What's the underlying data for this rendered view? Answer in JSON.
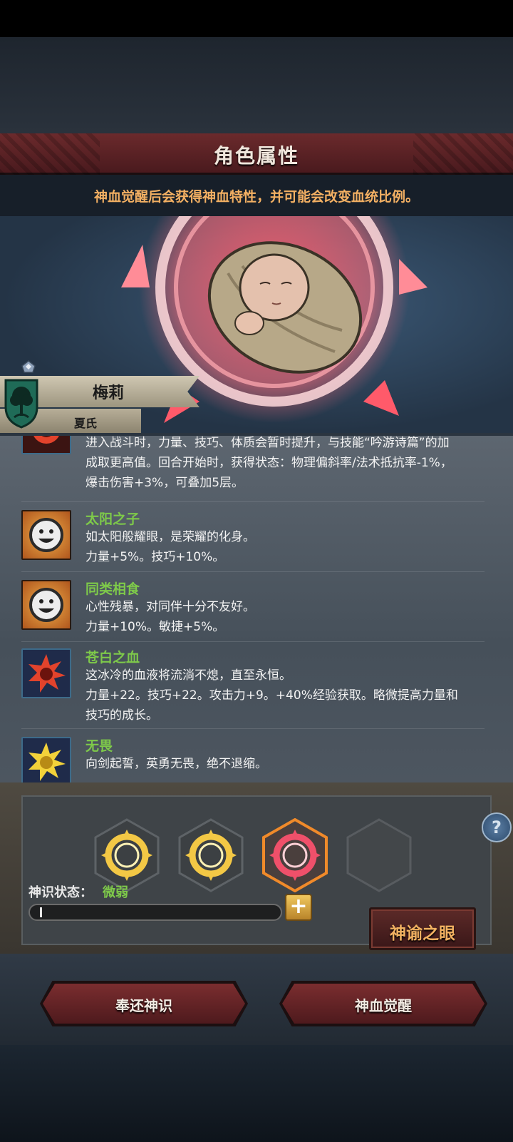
{
  "header": {
    "title": "角色属性",
    "subtitle": "神血觉醒后会获得神血特性，并可能会改变血统比例。"
  },
  "character": {
    "name": "梅莉",
    "family": "夏氏"
  },
  "traits": [
    {
      "name": "",
      "icon": "red-sun-icon",
      "lines": [
        "进入战斗时，力量、技巧、体质会暂时提升，与技能“吟游诗篇”的加",
        "成取更高值。回合开始时，获得状态：物理偏斜率/法术抵抗率-1%，",
        "爆击伤害+3%，可叠加5层。"
      ]
    },
    {
      "name": "太阳之子",
      "icon": "smiley-face-icon",
      "lines": [
        "如太阳般耀眼，是荣耀的化身。",
        "力量+5%。技巧+10%。"
      ]
    },
    {
      "name": "同类相食",
      "icon": "smiley-face-icon",
      "lines": [
        "心性残暴，对同伴十分不友好。",
        "力量+10%。敏捷+5%。"
      ]
    },
    {
      "name": "苍白之血",
      "icon": "red-sun-icon",
      "lines": [
        "这冰冷的血液将流淌不熄，直至永恒。",
        "力量+22。技巧+22。攻击力+9。+40%经验获取。略微提高力量和",
        "技巧的成长。"
      ]
    },
    {
      "name": "无畏",
      "icon": "yellow-sun-icon",
      "lines": [
        "向剑起誓，英勇无畏，绝不退缩。"
      ]
    }
  ],
  "divine": {
    "status_label": "神识状态：",
    "status_value": "微弱",
    "progress": 0.01,
    "slots": [
      "gold-sun-ring-icon",
      "gold-sun-ring-icon",
      "red-sun-ring-icon",
      "empty-slot"
    ],
    "help_label": "?",
    "plus_label": "+",
    "oracle_button": "神谕之眼"
  },
  "actions": {
    "return_label": "奉还神识",
    "awaken_label": "神血觉醒"
  },
  "colors": {
    "accent_orange": "#f3b063",
    "trait_green": "#7ec94a",
    "title_red": "#6b2a2c",
    "sun_red": "#f0506a"
  }
}
